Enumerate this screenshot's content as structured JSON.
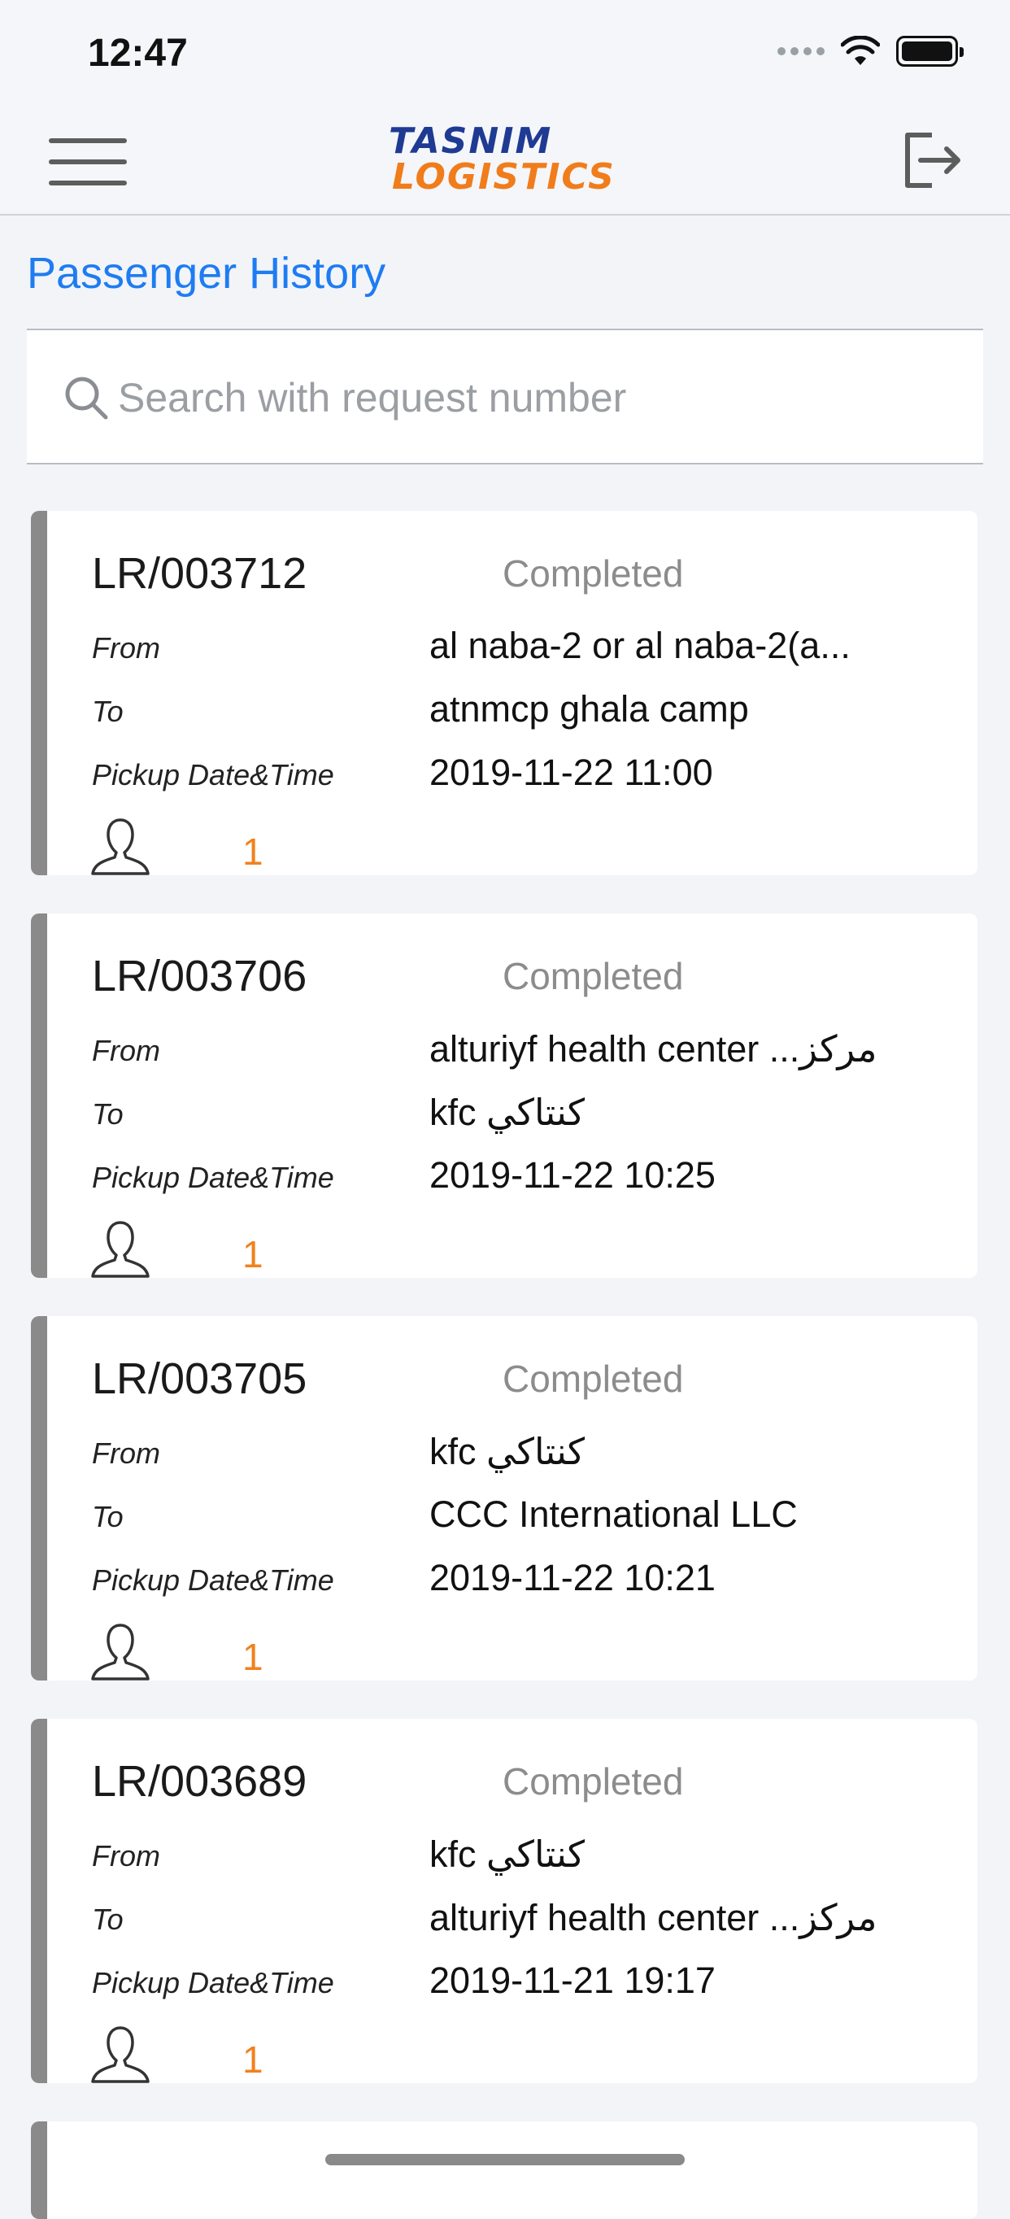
{
  "status_bar": {
    "time": "12:47"
  },
  "header": {
    "logo_line1": "TASNIM",
    "logo_line2": "LOGISTICS"
  },
  "page": {
    "title": "Passenger History",
    "search_placeholder": "Search with request number"
  },
  "labels": {
    "from": "From",
    "to": "To",
    "pickup": "Pickup Date&Time"
  },
  "requests": [
    {
      "number": "LR/003712",
      "status": "Completed",
      "from": "al naba-2 or al naba-2(a...",
      "to": "atnmcp ghala camp",
      "pickup": "2019-11-22 11:00",
      "passengers": "1"
    },
    {
      "number": "LR/003706",
      "status": "Completed",
      "from": "alturiyf health center ...مركز",
      "to": "kfc كنتاكي",
      "pickup": "2019-11-22 10:25",
      "passengers": "1"
    },
    {
      "number": "LR/003705",
      "status": "Completed",
      "from": "kfc كنتاكي",
      "to": "CCC International LLC",
      "pickup": "2019-11-22 10:21",
      "passengers": "1"
    },
    {
      "number": "LR/003689",
      "status": "Completed",
      "from": "kfc كنتاكي",
      "to": "alturiyf health center ...مركز",
      "pickup": "2019-11-21 19:17",
      "passengers": "1"
    }
  ],
  "colors": {
    "accent": "#1e7cf2",
    "count": "#f0821e",
    "status": "#8c8c8c",
    "card_stripe": "#8a8a8a"
  }
}
